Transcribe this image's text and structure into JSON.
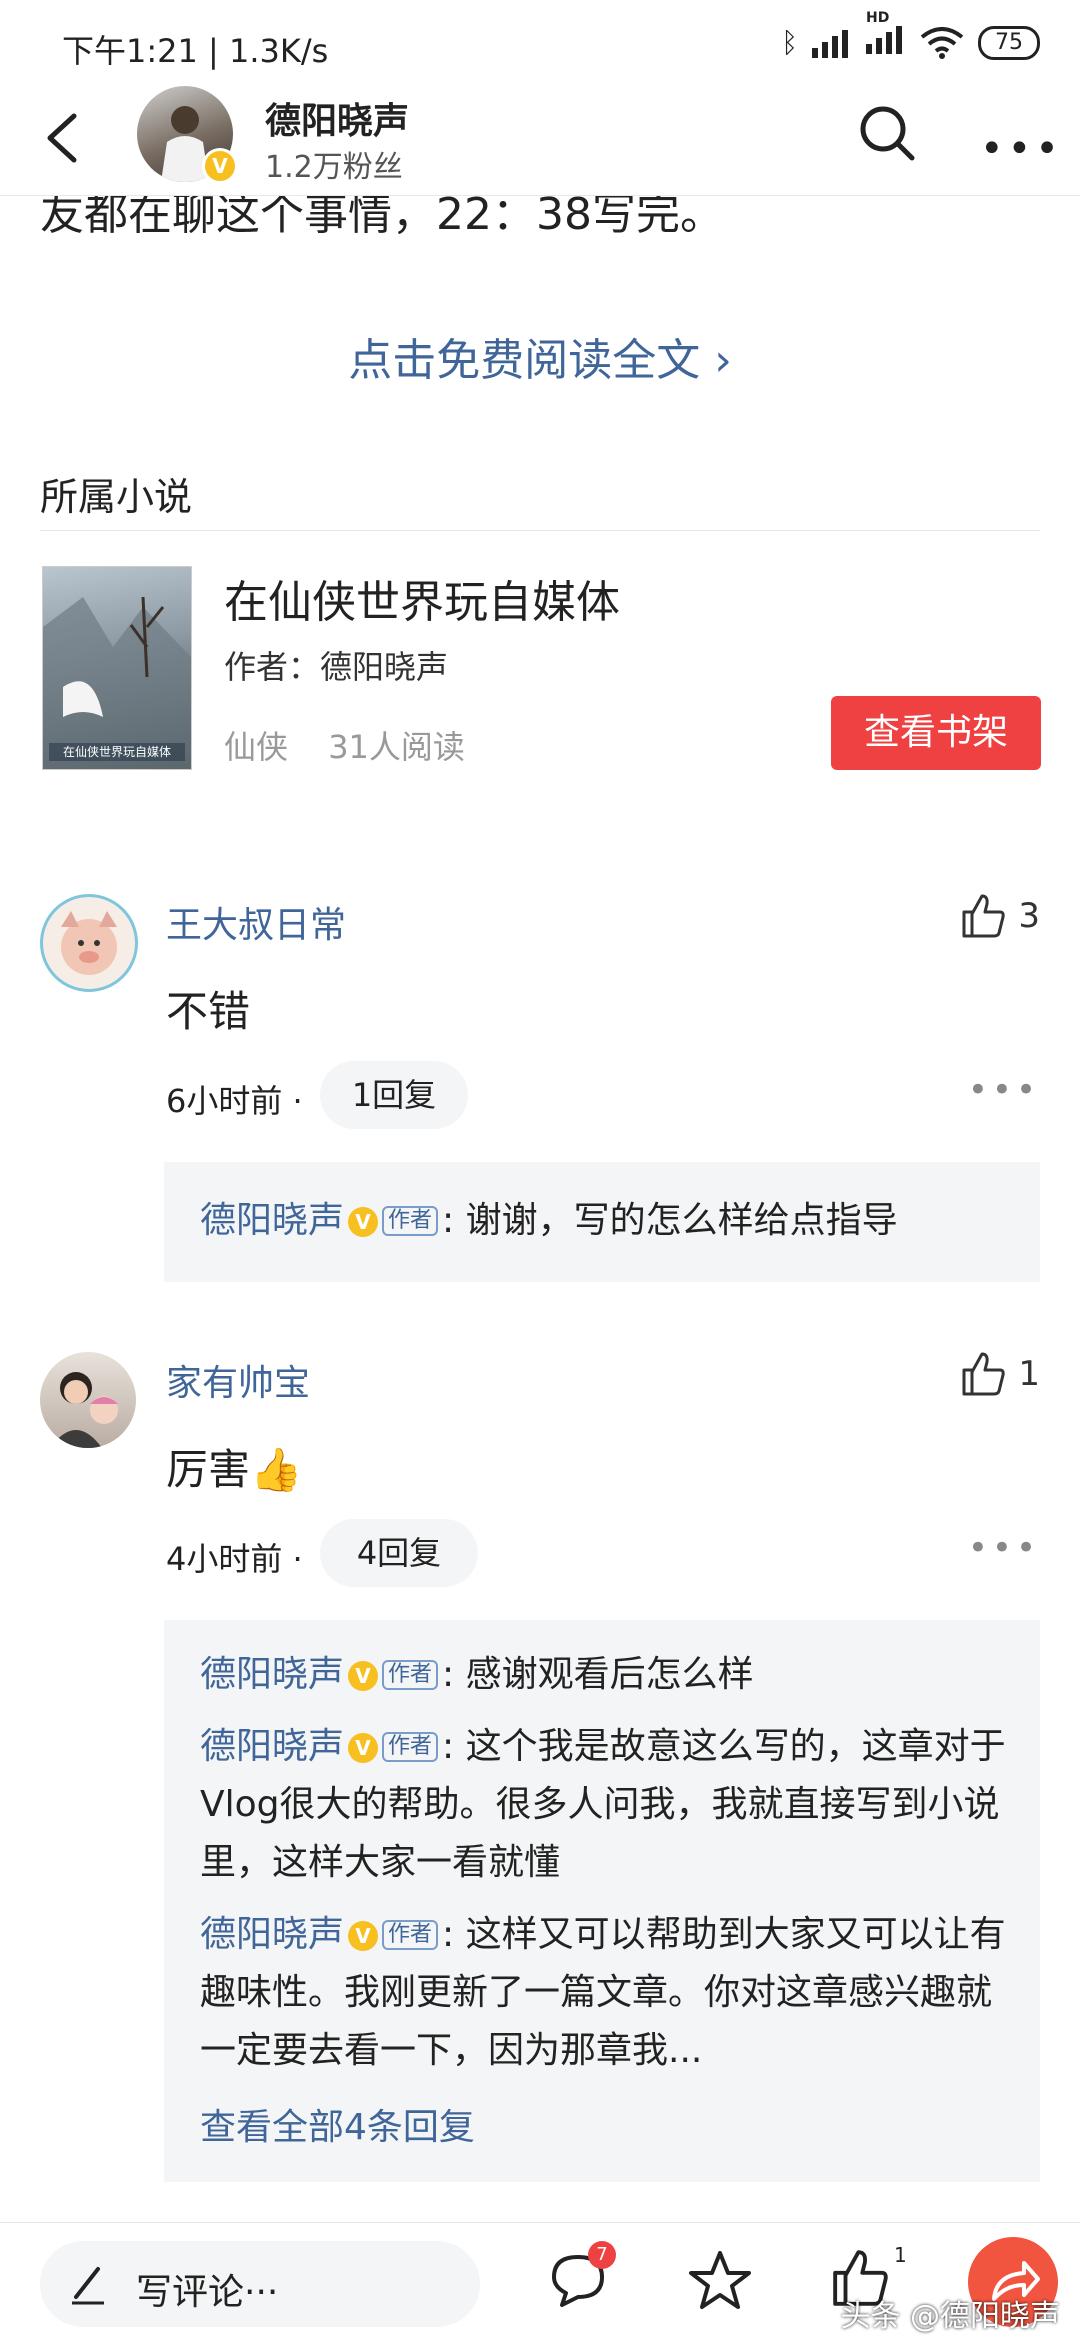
{
  "status": {
    "time": "下午1:21 | 1.3K/s",
    "hd": "HD",
    "battery": "75"
  },
  "header": {
    "name": "德阳晓声",
    "fans": "1.2万粉丝",
    "verified": "V"
  },
  "article": {
    "cut_text": "友都在聊这个事情，22：38写完。",
    "read_full": "点击免费阅读全文 ›"
  },
  "novel": {
    "section_title": "所属小说",
    "title": "在仙侠世界玩自媒体",
    "author": "作者：德阳晓声",
    "genre": "仙侠",
    "readers": "31人阅读",
    "shelf_button": "查看书架",
    "cover_text": "在仙侠世界玩自媒体"
  },
  "comments": [
    {
      "name": "王大叔日常",
      "likes": "3",
      "text": "不错",
      "time": "6小时前 ·",
      "replies_label": "1回复",
      "replies": [
        {
          "name": "德阳晓声",
          "tag": "作者",
          "text": ": 谢谢，写的怎么样给点指导"
        }
      ]
    },
    {
      "name": "家有帅宝",
      "likes": "1",
      "text": "厉害👍",
      "time": "4小时前 ·",
      "replies_label": "4回复",
      "replies": [
        {
          "name": "德阳晓声",
          "tag": "作者",
          "text": ": 感谢观看后怎么样"
        },
        {
          "name": "德阳晓声",
          "tag": "作者",
          "text": ": 这个我是故意这么写的，这章对于Vlog很大的帮助。很多人问我，我就直接写到小说里，这样大家一看就懂"
        },
        {
          "name": "德阳晓声",
          "tag": "作者",
          "text": ": 这样又可以帮助到大家又可以让有趣味性。我刚更新了一篇文章。你对这章感兴趣就一定要去看一下，因为那章我..."
        }
      ],
      "view_all": "查看全部4条回复"
    }
  ],
  "bottombar": {
    "write_placeholder": "写评论···",
    "comment_count": "7",
    "like_count": "1",
    "watermark": "头条 @德阳晓声"
  }
}
